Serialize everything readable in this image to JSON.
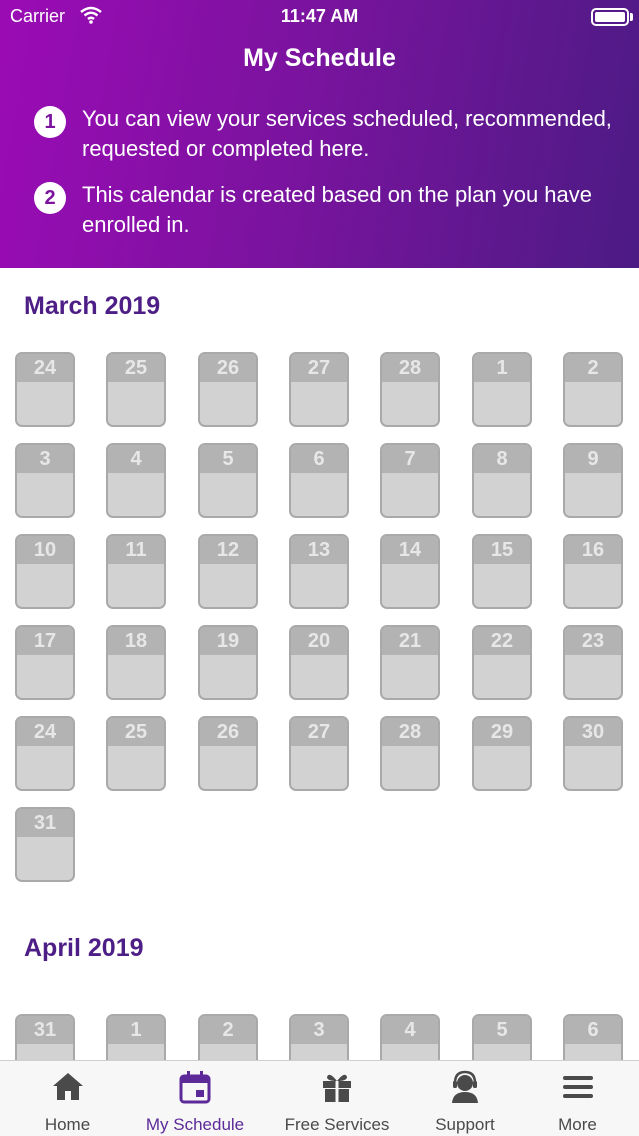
{
  "status_bar": {
    "carrier": "Carrier",
    "time": "11:47 AM"
  },
  "header": {
    "title": "My Schedule",
    "info": [
      {
        "num": "1",
        "text": "You can view your services scheduled, recommended, requested or completed here."
      },
      {
        "num": "2",
        "text": "This calendar is created based on the plan you have enrolled in."
      }
    ]
  },
  "months": [
    {
      "title": "March 2019",
      "days": [
        "24",
        "25",
        "26",
        "27",
        "28",
        "1",
        "2",
        "3",
        "4",
        "5",
        "6",
        "7",
        "8",
        "9",
        "10",
        "11",
        "12",
        "13",
        "14",
        "15",
        "16",
        "17",
        "18",
        "19",
        "20",
        "21",
        "22",
        "23",
        "24",
        "25",
        "26",
        "27",
        "28",
        "29",
        "30",
        "31"
      ]
    },
    {
      "title": "April 2019",
      "days": [
        "31",
        "1",
        "2",
        "3",
        "4",
        "5",
        "6"
      ]
    }
  ],
  "tabs": [
    {
      "label": "Home",
      "icon": "home-icon"
    },
    {
      "label": "My Schedule",
      "icon": "calendar-icon"
    },
    {
      "label": "Free Services",
      "icon": "gift-icon"
    },
    {
      "label": "Support",
      "icon": "support-agent-icon"
    },
    {
      "label": "More",
      "icon": "menu-icon"
    }
  ],
  "colors": {
    "accent": "#5c2a98",
    "header_start": "#9b0bb5",
    "header_end": "#4c1b84",
    "month_title": "#4d1e85"
  }
}
